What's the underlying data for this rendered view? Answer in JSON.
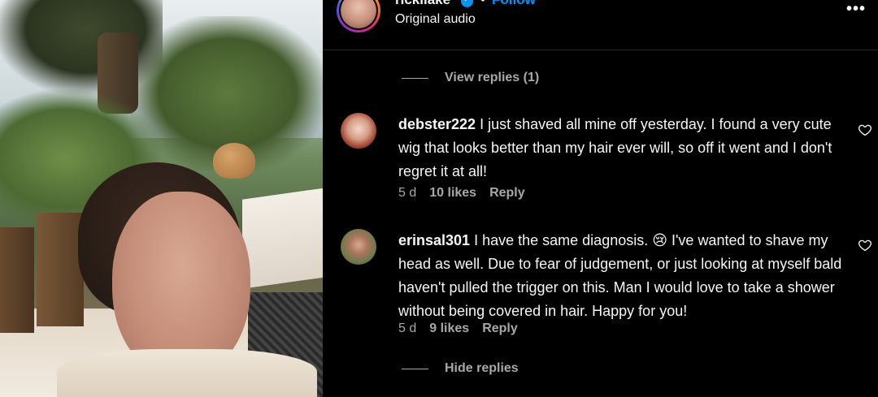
{
  "post": {
    "username": "rickilake",
    "follow_label": "Follow",
    "separator": "•",
    "audio_label": "Original audio",
    "more_label": "•••"
  },
  "view_replies_label": "View replies (1)",
  "hide_replies_label": "Hide replies",
  "comments": [
    {
      "username": "debster222",
      "text": "I just shaved all mine off yesterday. I found a very cute wig that looks better than my hair ever will, so off it went and I don't regret it at all!",
      "age": "5 d",
      "likes": "10 likes",
      "reply_label": "Reply",
      "avatar_icon": "user-avatar-woman-red-hair"
    },
    {
      "username": "erinsal301",
      "text": "I have the same diagnosis. 😢 I've wanted to shave my head as well. Due to fear of judgement, or just looking at myself bald haven't pulled the trigger on this. Man I would love to take a shower without being covered in hair. Happy for you!",
      "age": "5 d",
      "likes": "9 likes",
      "reply_label": "Reply",
      "avatar_icon": "user-avatar-woman-outdoors"
    }
  ],
  "colors": {
    "background": "#000000",
    "text": "#f5f5f5",
    "secondary_text": "#a8a8a8",
    "accent_blue": "#0095f6"
  }
}
